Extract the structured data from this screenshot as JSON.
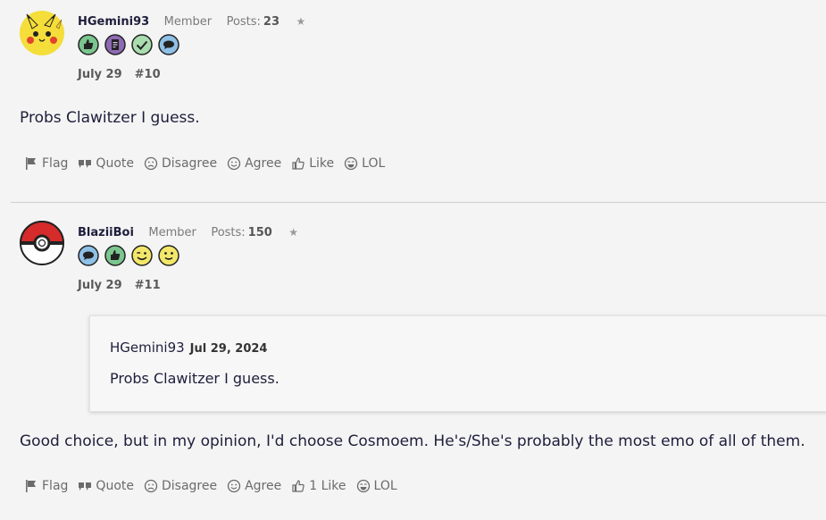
{
  "posts": [
    {
      "username": "HGemini93",
      "role": "Member",
      "posts_label": "Posts:",
      "posts_count": "23",
      "star": "★",
      "avatar": "pikachu-avatar",
      "badges": [
        "thumbs-up-badge-icon",
        "book-badge-icon",
        "check-badge-icon",
        "chat-badge-icon"
      ],
      "date": "July 29",
      "post_number": "#10",
      "body": "Probs Clawitzer I guess.",
      "actions": {
        "flag": "Flag",
        "quote": "Quote",
        "disagree": "Disagree",
        "agree": "Agree",
        "like": "Like",
        "lol": "LOL"
      }
    },
    {
      "username": "BlaziiBoi",
      "role": "Member",
      "posts_label": "Posts:",
      "posts_count": "150",
      "star": "★",
      "avatar": "pokeball-avatar",
      "badges": [
        "chat-badge-icon",
        "thumbs-up-badge-icon",
        "wink-badge-icon",
        "smile-badge-icon"
      ],
      "date": "July 29",
      "post_number": "#11",
      "quote": {
        "author": "HGemini93",
        "date": "Jul 29, 2024",
        "text": "Probs Clawitzer I guess."
      },
      "body": "Good choice, but in my opinion, I'd choose Cosmoem. He's/She's probably the most emo of all of them.",
      "actions": {
        "flag": "Flag",
        "quote": "Quote",
        "disagree": "Disagree",
        "agree": "Agree",
        "like": "1 Like",
        "lol": "LOL"
      }
    }
  ],
  "colors": {
    "background": "#f4f4f4",
    "text": "#1e1e3c",
    "muted": "#6b6b6b",
    "badge_green": "#7bc58f",
    "badge_blue": "#8fc0e6",
    "badge_purple": "#8e6ab3",
    "badge_yellow": "#f3e76b"
  }
}
